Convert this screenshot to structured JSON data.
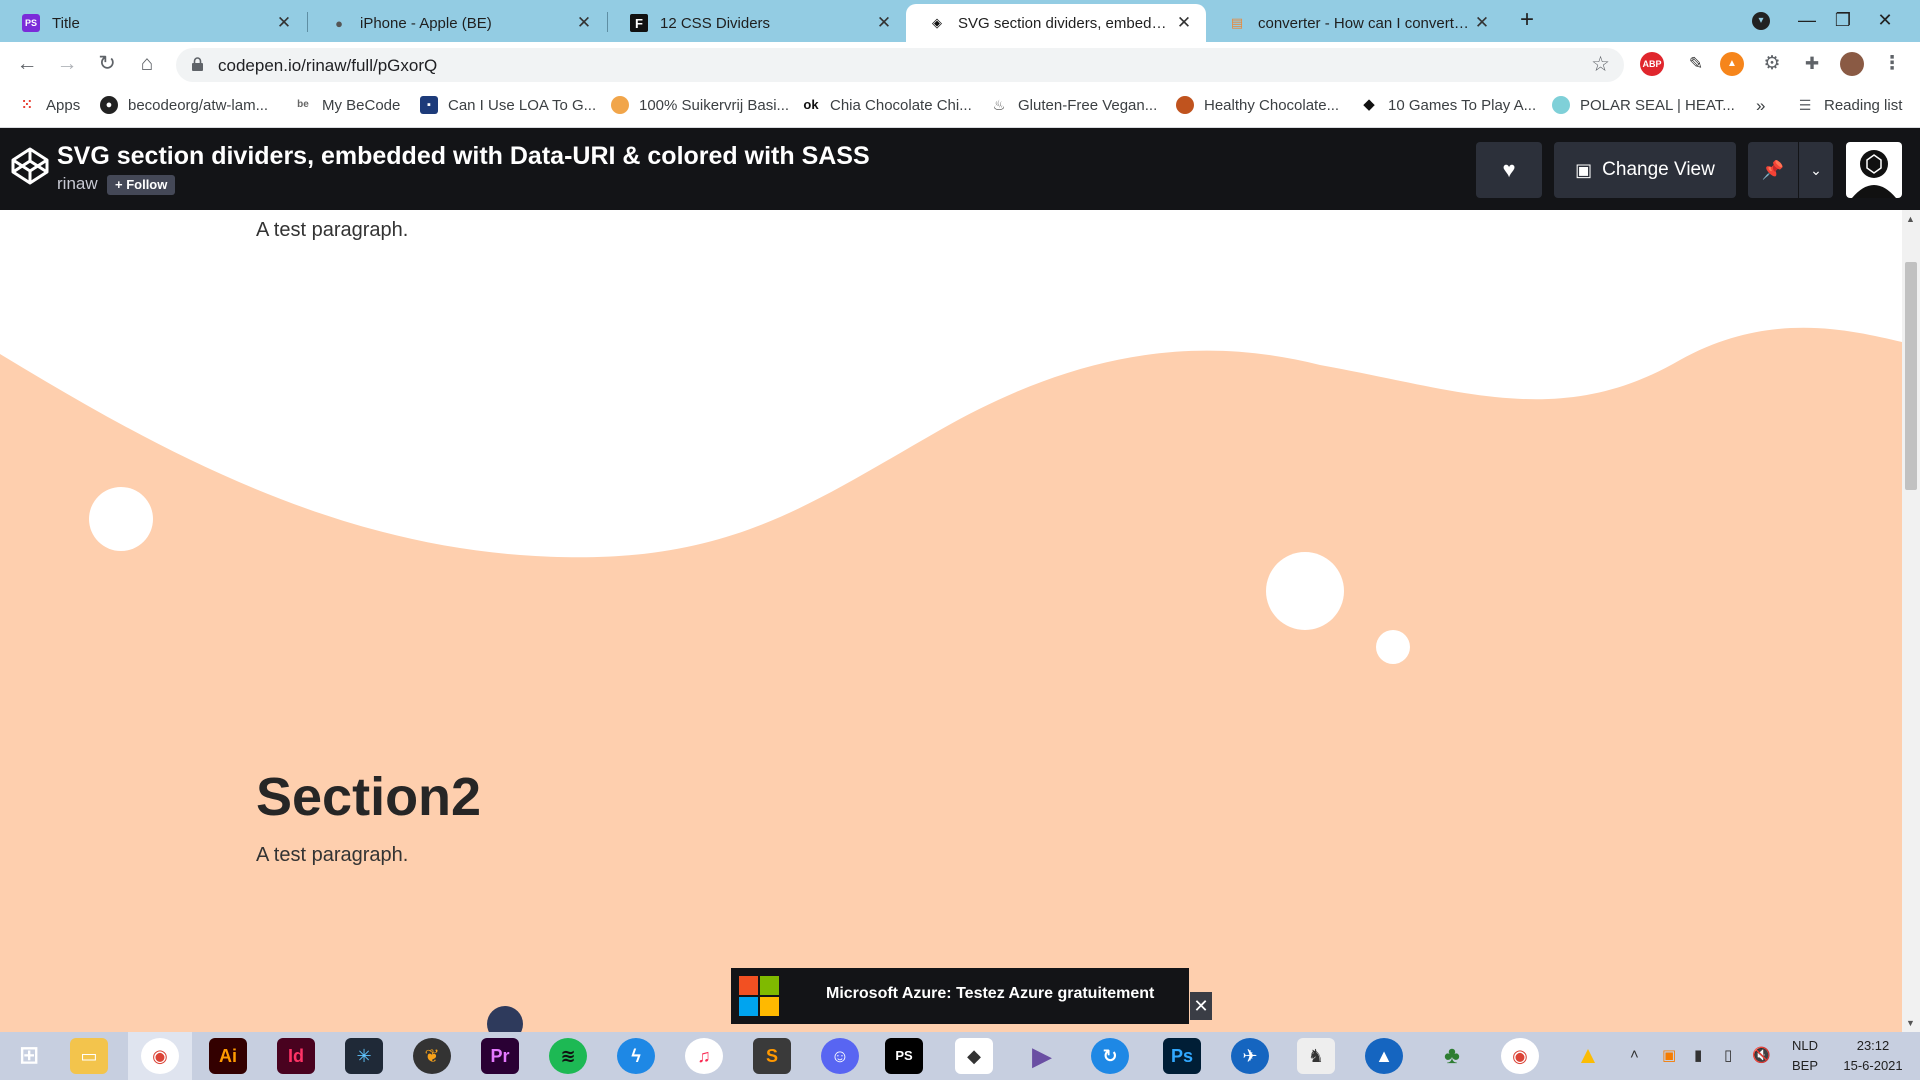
{
  "browser": {
    "tabs": [
      {
        "title": "Title",
        "icon": "phpstorm-icon"
      },
      {
        "title": "iPhone - Apple (BE)",
        "icon": "apple-icon"
      },
      {
        "title": "12 CSS Dividers",
        "icon": "f-icon"
      },
      {
        "title": "SVG section dividers, embedded",
        "icon": "codepen-icon",
        "active": true
      },
      {
        "title": "converter - How can I convert htm",
        "icon": "stackoverflow-icon"
      }
    ],
    "url": "codepen.io/rinaw/full/pGxorQ",
    "bookmarks": [
      {
        "label": "Apps",
        "icon": "apps-grid-icon"
      },
      {
        "label": "becodeorg/atw-lam...",
        "icon": "github-icon"
      },
      {
        "label": "My BeCode",
        "icon": "becode-icon"
      },
      {
        "label": "Can I Use LOA To G...",
        "icon": "loa-icon"
      },
      {
        "label": "100% Suikervrij Basi...",
        "icon": "bread-icon"
      },
      {
        "label": "Chia Chocolate Chi...",
        "icon": "ok-icon"
      },
      {
        "label": "Gluten-Free Vegan...",
        "icon": "cupcake-icon"
      },
      {
        "label": "Healthy Chocolate...",
        "icon": "cake-icon"
      },
      {
        "label": "10 Games To Play A...",
        "icon": "diamond-icon"
      },
      {
        "label": "POLAR SEAL | HEAT...",
        "icon": "seal-icon"
      }
    ],
    "bookmarks_more": "»",
    "reading_list": "Reading list",
    "extensions": [
      "ABP"
    ]
  },
  "codepen": {
    "title": "SVG section dividers, embedded with Data-URI & colored with SASS",
    "author": "rinaw",
    "follow": "+ Follow",
    "change_view": "Change View"
  },
  "page": {
    "para1": "A test paragraph.",
    "heading2": "Section2",
    "para2": "A test paragraph.",
    "colors": {
      "wave": "#fecfae",
      "background": "#ffffff"
    }
  },
  "ad": {
    "text": "Microsoft Azure: Testez Azure gratuitement",
    "close": "✕"
  },
  "taskbar": {
    "apps": [
      "Ai",
      "Id",
      "Pr",
      "Ps",
      "PS"
    ],
    "lang_top": "NLD",
    "lang_bottom": "BEP",
    "time": "23:12",
    "date": "15-6-2021"
  }
}
